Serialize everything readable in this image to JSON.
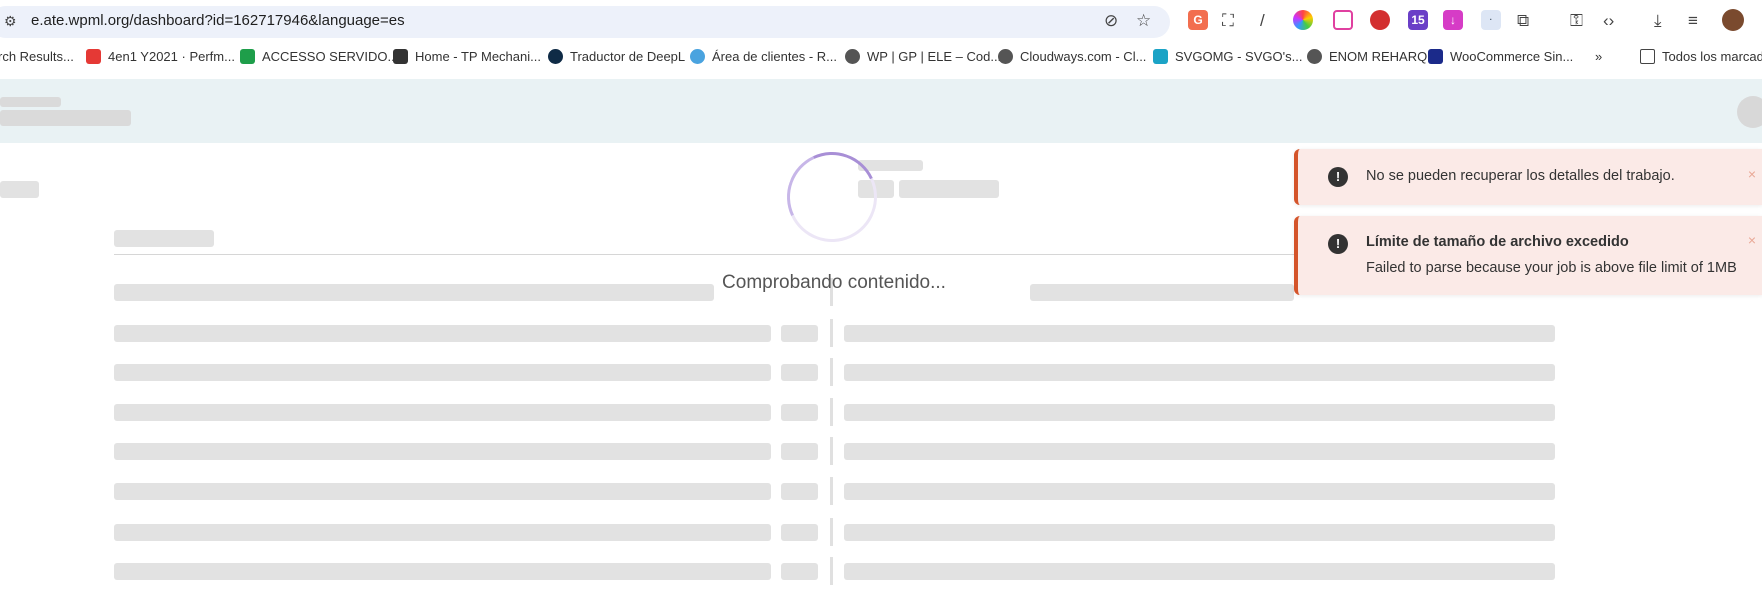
{
  "browser": {
    "url": "e.ate.wpml.org/dashboard?id=162717946&language=es",
    "extensions": [
      {
        "label": "G",
        "color": "#f26e4f"
      },
      {
        "label": "15",
        "color": "#6a3fc7"
      },
      {
        "label": "↓",
        "color": "#d63cc6"
      }
    ],
    "bookmarks": [
      {
        "label": "rch Results...",
        "color": "#ffffff"
      },
      {
        "label": "4en1 Y2021 · Perfm...",
        "color": "#e53935"
      },
      {
        "label": "ACCESSO SERVIDO...",
        "color": "#1e9e4a"
      },
      {
        "label": "Home - TP Mechani...",
        "color": "#333333"
      },
      {
        "label": "Traductor de DeepL",
        "color": "#0f2b46"
      },
      {
        "label": "Área de clientes - R...",
        "color": "#4aa3df"
      },
      {
        "label": "WP | GP | ELE – Cod...",
        "color": "#555555"
      },
      {
        "label": "Cloudways.com - Cl...",
        "color": "#555555"
      },
      {
        "label": "SVGOMG - SVGO's...",
        "color": "#1ba3c6"
      },
      {
        "label": "ENOM REHARQ",
        "color": "#555555"
      },
      {
        "label": "WooCommerce Sin...",
        "color": "#1b2a8a"
      }
    ],
    "more": "»",
    "all_bookmarks": "Todos los marcado"
  },
  "main": {
    "status": "Comprobando contenido..."
  },
  "toasts": [
    {
      "title": "No se pueden recuperar los detalles del trabajo.",
      "close": "×"
    },
    {
      "title": "Límite de tamaño de archivo excedido",
      "message": "Failed to parse because your job is above file limit of 1MB",
      "close": "×"
    }
  ]
}
